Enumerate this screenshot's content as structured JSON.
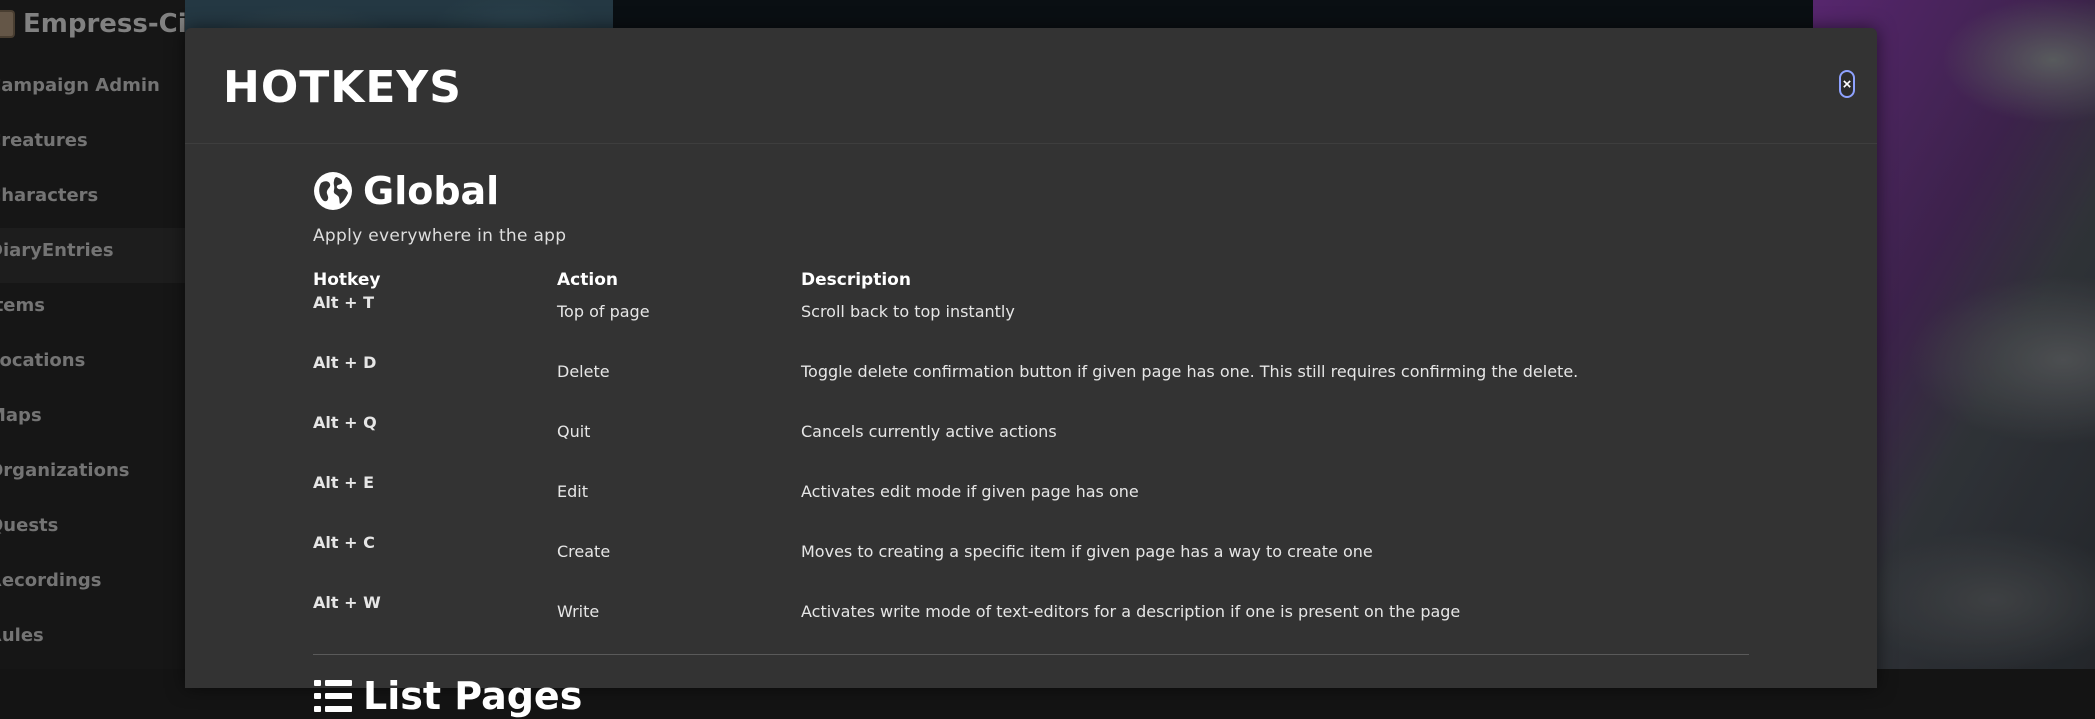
{
  "app": {
    "brand": "Empress-City",
    "nav": [
      {
        "label": "Campaign Admin"
      },
      {
        "label": "Creatures"
      },
      {
        "label": "Characters"
      },
      {
        "label": "DiaryEntries"
      },
      {
        "label": "Items"
      },
      {
        "label": "Locations"
      },
      {
        "label": "Maps"
      },
      {
        "label": "Organizations"
      },
      {
        "label": "Quests"
      },
      {
        "label": "Recordings"
      },
      {
        "label": "Rules"
      }
    ]
  },
  "modal": {
    "title": "HOTKEYS",
    "close_label": "×",
    "sections": [
      {
        "icon": "globe-icon",
        "title": "Global",
        "subtitle": "Apply everywhere in the app",
        "columns": [
          "Hotkey",
          "Action",
          "Description"
        ],
        "rows": [
          {
            "hotkey": "Alt + T",
            "action": "Top of page",
            "description": "Scroll back to top instantly"
          },
          {
            "hotkey": "Alt + D",
            "action": "Delete",
            "description": "Toggle delete confirmation button if given page has one. This still requires confirming the delete."
          },
          {
            "hotkey": "Alt + Q",
            "action": "Quit",
            "description": "Cancels currently active actions"
          },
          {
            "hotkey": "Alt + E",
            "action": "Edit",
            "description": "Activates edit mode if given page has one"
          },
          {
            "hotkey": "Alt + C",
            "action": "Create",
            "description": "Moves to creating a specific item if given page has a way to create one"
          },
          {
            "hotkey": "Alt + W",
            "action": "Write",
            "description": "Activates write mode of text-editors for a description if one is present on the page"
          }
        ]
      },
      {
        "icon": "list-icon",
        "title": "List Pages"
      }
    ]
  },
  "colors": {
    "modal_bg": "#333333",
    "sidebar_bg": "#1c1c1c",
    "close_focus_ring": "#8ea2ff"
  }
}
